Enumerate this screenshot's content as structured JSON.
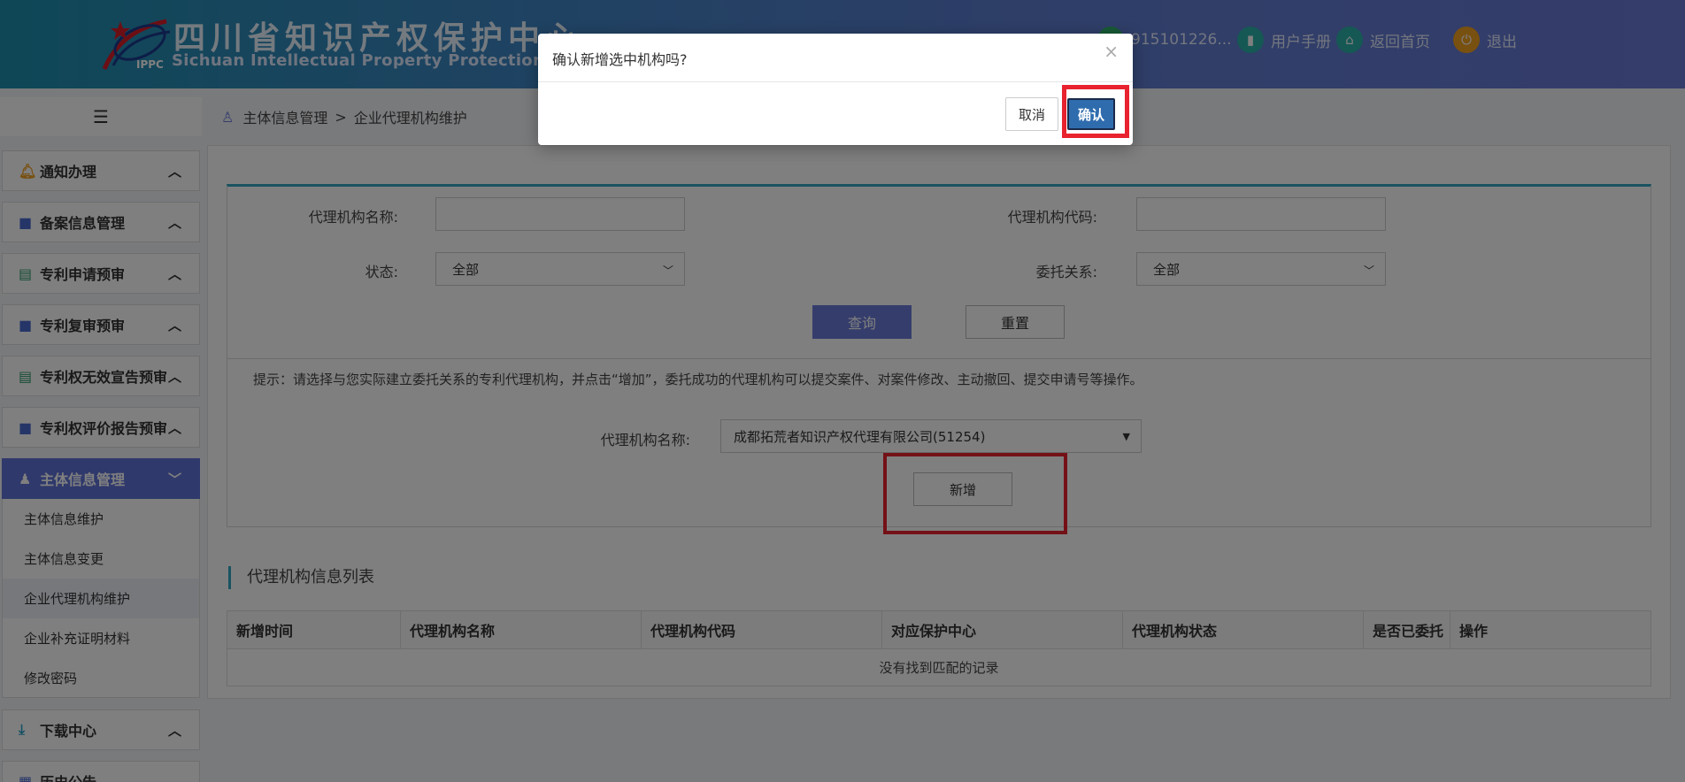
{
  "header": {
    "title_cn": "四川省知识产权保护中心",
    "title_en": "Sichuan Intellectual Property Protection Center",
    "logo_abbr": "IPPC",
    "user_id": "915101226...",
    "manual": "用户手册",
    "home": "返回首页",
    "exit": "退出"
  },
  "sidebar": {
    "groups": [
      {
        "label": "通知办理",
        "icon": "bell-icon"
      },
      {
        "label": "备案信息管理",
        "icon": "folder-icon"
      },
      {
        "label": "专利申请预审",
        "icon": "document-icon"
      },
      {
        "label": "专利复审预审",
        "icon": "folder-icon"
      },
      {
        "label": "专利权无效宣告预审",
        "icon": "document-icon"
      },
      {
        "label": "专利权评价报告预审",
        "icon": "folder-icon"
      },
      {
        "label": "主体信息管理",
        "icon": "user-icon"
      },
      {
        "label": "下载中心",
        "icon": "download-icon"
      },
      {
        "label": "历史公告",
        "icon": "archive-icon"
      }
    ],
    "subitems": [
      "主体信息维护",
      "主体信息变更",
      "企业代理机构维护",
      "企业补充证明材料",
      "修改密码"
    ]
  },
  "breadcrumb": {
    "parent": "主体信息管理",
    "sep": ">",
    "current": "企业代理机构维护"
  },
  "search": {
    "name_label": "代理机构名称:",
    "code_label": "代理机构代码:",
    "status_label": "状态:",
    "status_value": "全部",
    "entrust_label": "委托关系:",
    "entrust_value": "全部",
    "query": "查询",
    "reset": "重置"
  },
  "add": {
    "hint": "提示：请选择与您实际建立委托关系的专利代理机构，并点击“增加”，委托成功的代理机构可以提交案件、对案件修改、主动撤回、提交申请号等操作。",
    "agency_label": "代理机构名称:",
    "agency_value": "成都拓荒者知识产权代理有限公司(51254)",
    "add_button": "新增"
  },
  "list": {
    "title": "代理机构信息列表",
    "columns": [
      "新增时间",
      "代理机构名称",
      "代理机构代码",
      "对应保护中心",
      "代理机构状态",
      "是否已委托",
      "操作"
    ],
    "empty": "没有找到匹配的记录"
  },
  "dialog": {
    "message": "确认新增选中机构吗?",
    "cancel": "取消",
    "ok": "确认"
  },
  "colors": {
    "accent": "#5e73d8",
    "highlight": "#e8222e",
    "confirm": "#2f6cae"
  }
}
